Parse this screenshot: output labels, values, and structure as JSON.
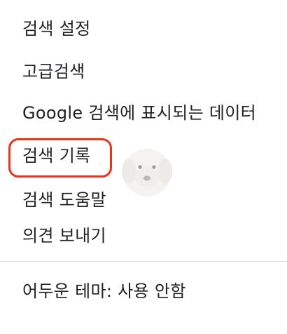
{
  "menu": {
    "items": [
      {
        "label": "검색 설정"
      },
      {
        "label": "고급검색"
      },
      {
        "label": "Google 검색에 표시되는 데이터"
      },
      {
        "label": "검색 기록"
      },
      {
        "label": "검색 도움말"
      },
      {
        "label": "의견 보내기"
      }
    ],
    "theme_item": {
      "label": "어두운 테마: 사용 안함"
    }
  },
  "colors": {
    "text": "#202124",
    "divider": "#dadce0",
    "highlight_border": "#e8331c"
  }
}
